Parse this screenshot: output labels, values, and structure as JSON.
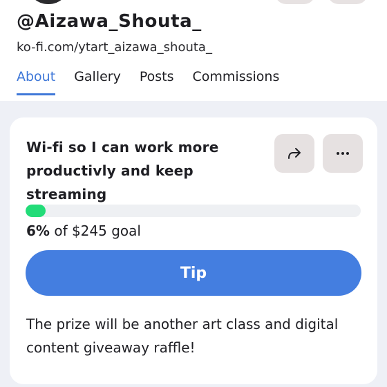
{
  "profile": {
    "username": "@Aizawa_Shouta_",
    "url": "ko-fi.com/ytart_aizawa_shouta_"
  },
  "tabs": [
    {
      "label": "About",
      "active": true
    },
    {
      "label": "Gallery",
      "active": false
    },
    {
      "label": "Posts",
      "active": false
    },
    {
      "label": "Commissions",
      "active": false
    }
  ],
  "goal": {
    "title": "Wi-fi so I can work more productivly and keep streaming",
    "progress_percent": 6,
    "progress_percent_label": "6%",
    "progress_suffix": " of $245 goal",
    "tip_label": "Tip",
    "description": "The prize will be another art class and digital content giveaway raffle!",
    "share_icon": "share-arrow-icon",
    "more_icon": "more-dots-icon"
  },
  "colors": {
    "accent": "#447ee0",
    "active_tab": "#3f78d8",
    "progress": "#22dc78",
    "background": "#eef0f6"
  }
}
